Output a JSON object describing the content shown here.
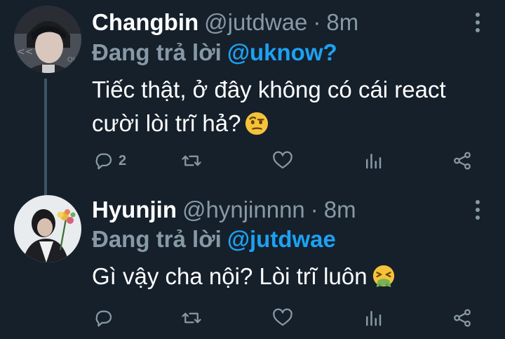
{
  "tweets": [
    {
      "name": "Changbin",
      "handle": "@jutdwae",
      "separator": "·",
      "time": "8m",
      "reply_prefix": "Đang trả lời",
      "reply_to": "@uknow?",
      "text_line1": "Tiếc thật, ở đây không có cái react",
      "text_line2": "cười lòi trĩ hả?",
      "emoji": "face-with-raised-eyebrow",
      "reply_count": "2"
    },
    {
      "name": "Hyunjin",
      "handle": "@hynjinnnn",
      "separator": "·",
      "time": "8m",
      "reply_prefix": "Đang trả lời",
      "reply_to": "@jutdwae",
      "text_line1": "Gì vậy cha nội? Lòi trĩ luôn",
      "emoji": "nauseated-vomiting-face",
      "reply_count": ""
    }
  ],
  "colors": {
    "background": "#15202b",
    "muted": "#8899a6",
    "accent": "#1da1f2",
    "thread_line": "#3d5466"
  }
}
